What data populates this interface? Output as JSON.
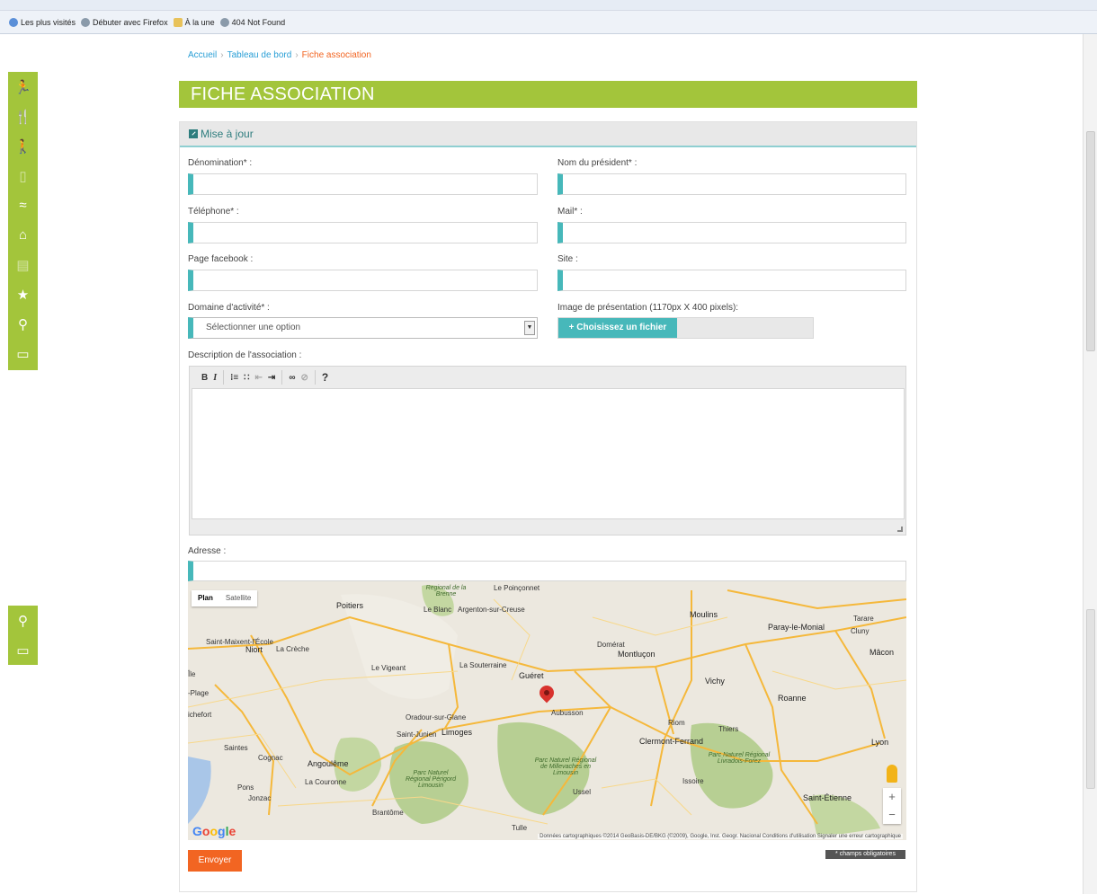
{
  "browser": {
    "bookmarks": [
      {
        "label": "Les plus visités",
        "icon": "globe-icon"
      },
      {
        "label": "Débuter avec Firefox",
        "icon": "firefox-icon"
      },
      {
        "label": "À la une",
        "icon": "rss-folder-icon"
      },
      {
        "label": "404 Not Found",
        "icon": "globe-icon"
      }
    ]
  },
  "sidebar": {
    "top_items": [
      {
        "icon": "runner-icon",
        "glyph": "🏃"
      },
      {
        "icon": "restaurant-icon",
        "glyph": "🍴"
      },
      {
        "icon": "hiking-icon",
        "glyph": "🚶"
      },
      {
        "icon": "document-icon",
        "glyph": "▯"
      },
      {
        "icon": "swimming-icon",
        "glyph": "≈"
      },
      {
        "icon": "home-icon",
        "glyph": "⌂"
      },
      {
        "icon": "file-icon",
        "glyph": "▤"
      },
      {
        "icon": "star-icon",
        "glyph": "★"
      },
      {
        "icon": "map-pin-icon",
        "glyph": "⚲"
      },
      {
        "icon": "card-icon",
        "glyph": "▭"
      }
    ],
    "bottom_items": [
      {
        "icon": "map-pin-icon",
        "glyph": "⚲"
      },
      {
        "icon": "card-icon",
        "glyph": "▭"
      }
    ]
  },
  "breadcrumb": {
    "home": "Accueil",
    "separator": "›",
    "dashboard": "Tableau de bord",
    "current": "Fiche association"
  },
  "page": {
    "title": "FICHE ASSOCIATION"
  },
  "panel": {
    "heading": "Mise à jour"
  },
  "form": {
    "denomination_label": "Dénomination* :",
    "denomination_value": "",
    "president_label": "Nom du président* :",
    "president_value": "",
    "phone_label": "Téléphone* :",
    "phone_value": "",
    "mail_label": "Mail* :",
    "mail_value": "",
    "facebook_label": "Page facebook :",
    "facebook_value": "",
    "site_label": "Site :",
    "site_value": "",
    "domain_label": "Domaine d'activité* :",
    "domain_selected": "Sélectionner une option",
    "image_label": "Image de présentation (1170px X 400 pixels):",
    "file_button": "+ Choisissez un fichier",
    "description_label": "Description de l'association :",
    "address_label": "Adresse :",
    "address_value": "",
    "submit": "Envoyer",
    "required_note": "* champs obligatoires"
  },
  "editor": {
    "bold": "B",
    "italic": "I",
    "ordered_list": "⁝≡",
    "unordered_list": "∷",
    "outdent": "⇤",
    "indent": "⇥",
    "link": "∞",
    "unlink": "⊘",
    "help": "?"
  },
  "map": {
    "plan": "Plan",
    "satellite": "Satellite",
    "logo": "Google",
    "attribution": "Données cartographiques ©2014 GeoBasis-DE/BKG (©2009), Google, Inst. Geogr. Nacional   Conditions d'utilisation   Signaler une erreur cartographique",
    "zoom_in": "+",
    "zoom_out": "−",
    "places": {
      "poitiers": "Poitiers",
      "niort": "Niort",
      "creche": "La Crèche",
      "limoges": "Limoges",
      "gueret": "Guéret",
      "aubusson": "Aubusson",
      "montlucon": "Montluçon",
      "vichy": "Vichy",
      "moulins": "Moulins",
      "clermont": "Clermont-Ferrand",
      "riom": "Riom",
      "thiers": "Thiers",
      "roanne": "Roanne",
      "lyon": "Lyon",
      "saint_etienne": "Saint-Étienne",
      "issoire": "Issoire",
      "ussel": "Ussel",
      "tulle": "Tulle",
      "angouleme": "Angoulême",
      "saintes": "Saintes",
      "cognac": "Cognac",
      "rochefort": "ichefort",
      "saint_junien": "Saint-Junien",
      "oradour": "Oradour-sur-Glane",
      "souterraine": "La Souterraine",
      "vigeant": "Le Vigeant",
      "argenton": "Argenton-sur-Creuse",
      "le_blanc": "Le Blanc",
      "poinconnet": "Le Poinçonnet",
      "paray": "Paray-le-Monial",
      "cluny": "Cluny",
      "macon": "Mâcon",
      "tarare": "Tarare",
      "domerat": "Domérat",
      "brantome": "Brantôme",
      "jonzac": "Jonzac",
      "pons": "Pons",
      "couronne": "La Couronne",
      "plage": "-Plage",
      "ile": "Île",
      "saint_maixent": "Saint-Maixent-l'École",
      "park_brenne": "Regional de la Brenne",
      "park_millevaches": "Parc Naturel Régional de Millevaches en Limousin",
      "park_perigord": "Parc Naturel Régional Périgord Limousin",
      "park_livradois": "Parc Naturel Régional Livradois-Forez"
    }
  }
}
